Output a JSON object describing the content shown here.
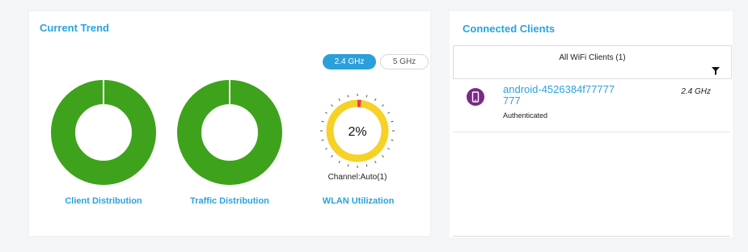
{
  "current_trend": {
    "title": "Current Trend",
    "charts": [
      {
        "label": "Client Distribution",
        "share": 1.0,
        "color": "#3fa21d"
      },
      {
        "label": "Traffic Distribution",
        "share": 1.0,
        "color": "#3fa21d"
      }
    ],
    "band_options": [
      {
        "label": "2.4 GHz",
        "selected": true
      },
      {
        "label": "5 GHz",
        "selected": false
      }
    ],
    "wlan": {
      "label": "WLAN Utilization",
      "value_text": "2%",
      "utilization": 0.02,
      "channel": "Channel:Auto(1)",
      "colors": {
        "used": "#e8404a",
        "free": "#f6d126"
      }
    }
  },
  "connected_clients": {
    "title": "Connected Clients",
    "filter_label": "All WiFi Clients (1)",
    "clients": [
      {
        "name": "android-4526384f77777777",
        "status": "Authenticated",
        "band": "2.4 GHz"
      }
    ]
  },
  "colors": {
    "accent": "#29a3df",
    "donut_green": "#3fa21d",
    "avatar_purple": "#7b2a86"
  },
  "icons": {
    "filter": "filter-icon",
    "client_device": "mobile-phone-icon"
  }
}
